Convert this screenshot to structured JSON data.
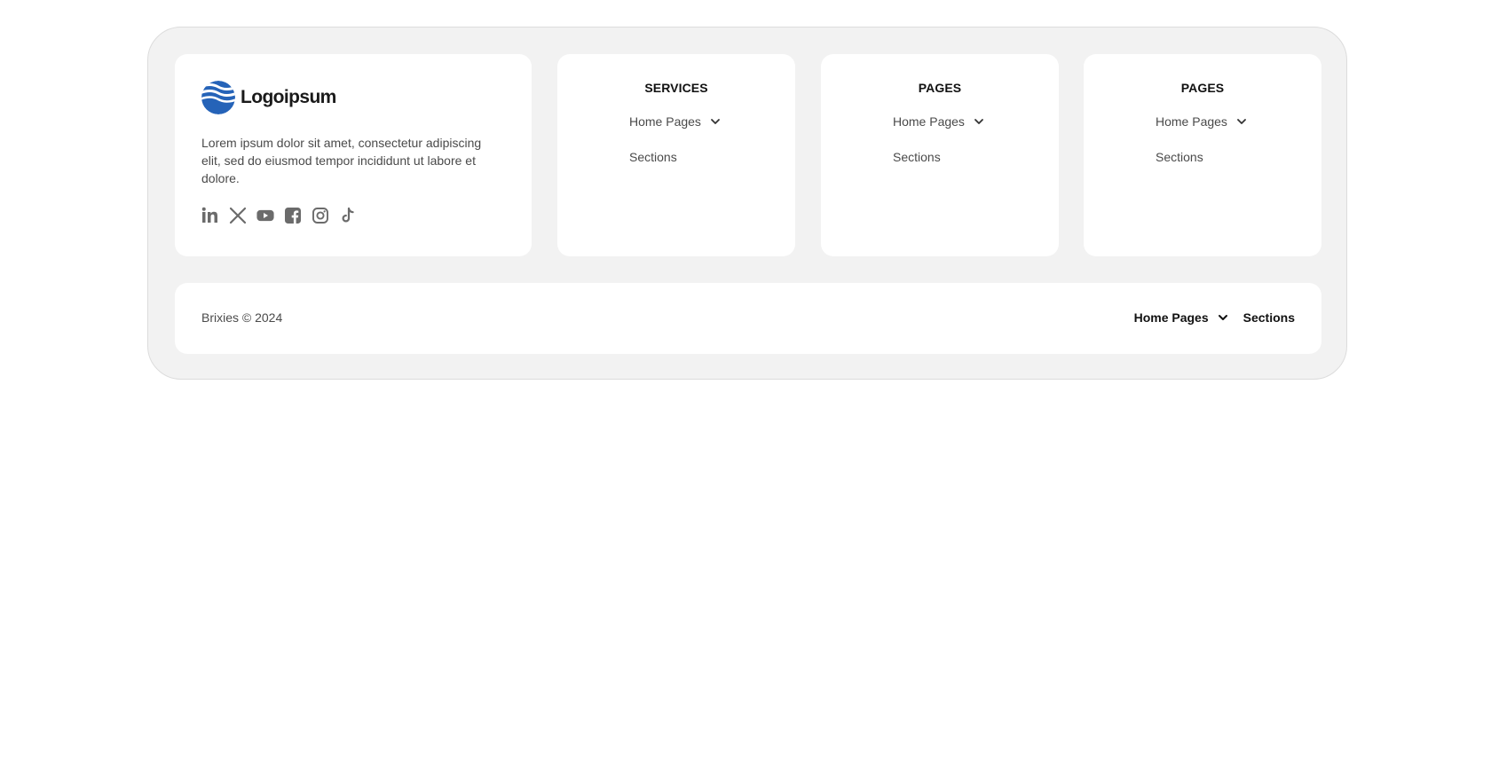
{
  "brand": {
    "logo_text": "Logoipsum",
    "logo_color": "#2563b8",
    "description": "Lorem ipsum dolor sit amet, consectetur adipiscing elit, sed do eiusmod tempor incididunt ut labore et dolore.",
    "socials": [
      "linkedin-icon",
      "x-icon",
      "youtube-icon",
      "facebook-icon",
      "instagram-icon",
      "tiktok-icon"
    ]
  },
  "columns": [
    {
      "title": "SERVICES",
      "links": [
        {
          "label": "Home Pages",
          "has_dropdown": true
        },
        {
          "label": "Sections",
          "has_dropdown": false
        }
      ]
    },
    {
      "title": "PAGES",
      "links": [
        {
          "label": "Home Pages",
          "has_dropdown": true
        },
        {
          "label": "Sections",
          "has_dropdown": false
        }
      ]
    },
    {
      "title": "PAGES",
      "links": [
        {
          "label": "Home Pages",
          "has_dropdown": true
        },
        {
          "label": "Sections",
          "has_dropdown": false
        }
      ]
    }
  ],
  "bottom": {
    "copyright": "Brixies © 2024",
    "nav": [
      {
        "label": "Home Pages",
        "has_dropdown": true
      },
      {
        "label": "Sections",
        "has_dropdown": false
      }
    ]
  },
  "colors": {
    "panel": "#f2f2f2",
    "card": "#ffffff",
    "icon": "#6b6b6b"
  }
}
